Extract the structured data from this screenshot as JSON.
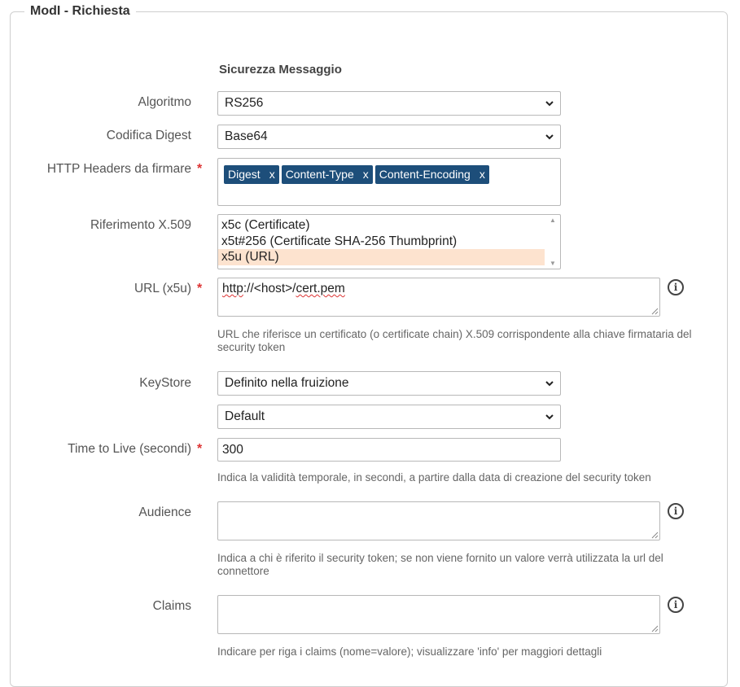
{
  "fieldset": {
    "legend": "ModI - Richiesta"
  },
  "section_title": "Sicurezza Messaggio",
  "algoritmo": {
    "label": "Algoritmo",
    "value": "RS256"
  },
  "codifica_digest": {
    "label": "Codifica Digest",
    "value": "Base64"
  },
  "http_headers": {
    "label": "HTTP Headers da firmare",
    "required_mark": "*",
    "tags": [
      {
        "label": "Digest",
        "remove": "x"
      },
      {
        "label": "Content-Type",
        "remove": "x"
      },
      {
        "label": "Content-Encoding",
        "remove": "x"
      }
    ]
  },
  "riferimento_x509": {
    "label": "Riferimento X.509",
    "options": [
      "x5c (Certificate)",
      "x5t#256 (Certificate SHA-256 Thumbprint)",
      "x5u (URL)"
    ],
    "selected_index": 2
  },
  "url_x5u": {
    "label": "URL (x5u)",
    "required_mark": "*",
    "value_parts": [
      "http",
      "://<host>/",
      "cert.pem"
    ],
    "hint": "URL che riferisce un certificato (o certificate chain) X.509 corrispondente alla chiave firmataria del security token",
    "info": "i"
  },
  "keystore": {
    "label": "KeyStore",
    "value": "Definito nella fruizione",
    "value2": "Default"
  },
  "ttl": {
    "label": "Time to Live (secondi)",
    "required_mark": "*",
    "value": "300",
    "hint": "Indica la validità temporale, in secondi, a partire dalla data di creazione del security token"
  },
  "audience": {
    "label": "Audience",
    "value": "",
    "hint": "Indica a chi è riferito il security token; se non viene fornito un valore verrà utilizzata la url del connettore",
    "info": "i"
  },
  "claims": {
    "label": "Claims",
    "value": "",
    "hint": "Indicare per riga i claims (nome=valore); visualizzare 'info' per maggiori dettagli",
    "info": "i"
  }
}
